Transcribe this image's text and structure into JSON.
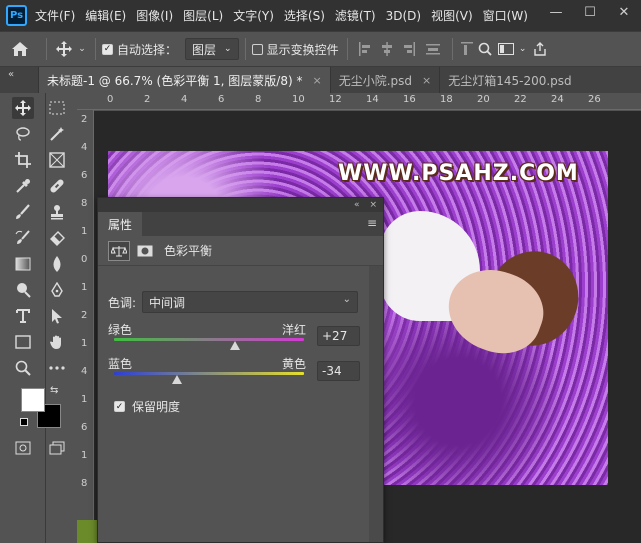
{
  "app": {
    "logo_text": "Ps"
  },
  "menu": {
    "items": [
      "文件(F)",
      "编辑(E)",
      "图像(I)",
      "图层(L)",
      "文字(Y)",
      "选择(S)",
      "滤镜(T)",
      "3D(D)",
      "视图(V)",
      "窗口(W)"
    ]
  },
  "window_controls": {
    "minimize": "—",
    "maximize": "☐",
    "close": "✕"
  },
  "options": {
    "auto_select_label": "自动选择：",
    "auto_select_checked": true,
    "layer_select_value": "图层",
    "show_transform_label": "显示变换控件",
    "show_transform_checked": false
  },
  "tabs": [
    {
      "label": "未标题-1 @ 66.7% (色彩平衡 1, 图层蒙版/8) *",
      "active": true,
      "close": "×"
    },
    {
      "label": "无尘小院.psd",
      "active": false,
      "close": "×"
    },
    {
      "label": "无尘灯箱145-200.psd",
      "active": false,
      "close": ""
    }
  ],
  "ruler": {
    "top": [
      "0",
      "2",
      "4",
      "6",
      "8",
      "10",
      "12",
      "14",
      "16",
      "18",
      "20",
      "22",
      "24",
      "26"
    ],
    "left": [
      "2",
      "4",
      "6",
      "8",
      "1",
      "0",
      "1",
      "2",
      "1",
      "4",
      "1",
      "6",
      "1",
      "8"
    ]
  },
  "canvas": {
    "watermark": "WWW.PSAHZ.COM"
  },
  "properties": {
    "panel_title": "属性",
    "collapse_glyph": "«",
    "close_glyph": "×",
    "adjustment_name": "色彩平衡",
    "tone_label": "色调:",
    "tone_value": "中间调",
    "slider1": {
      "left_label": "绿色",
      "right_label": "洋红",
      "value": "+27",
      "level": 27
    },
    "slider2": {
      "left_label": "蓝色",
      "right_label": "黄色",
      "value": "-34",
      "level": -34
    },
    "preserve_label": "保留明度",
    "preserve_checked": true
  },
  "colors": {
    "accent": "#31a8ff",
    "green_track": "#3fbf3f",
    "magenta_track": "#d23ad2",
    "blue_track": "#2c3fd6",
    "yellow_track": "#e6e02a"
  }
}
